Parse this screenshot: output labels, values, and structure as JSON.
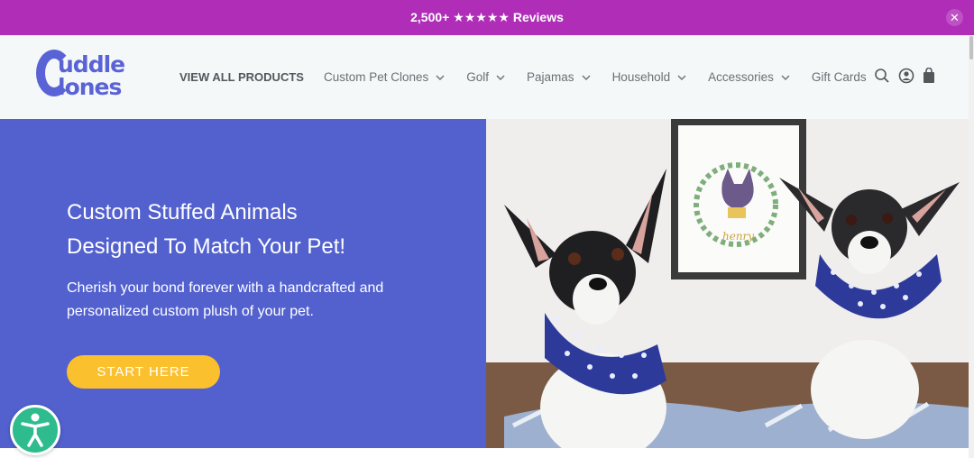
{
  "announcement": {
    "text": "2,500+ ★★★★★ Reviews",
    "close_icon": "close-icon"
  },
  "logo": {
    "line1": "uddle",
    "line2": "lones",
    "alt": "Cuddle Clones"
  },
  "nav": {
    "items": [
      {
        "label": "VIEW ALL PRODUCTS",
        "dropdown": false
      },
      {
        "label": "Custom Pet Clones",
        "dropdown": true
      },
      {
        "label": "Golf",
        "dropdown": true
      },
      {
        "label": "Pajamas",
        "dropdown": true
      },
      {
        "label": "Household",
        "dropdown": true
      },
      {
        "label": "Accessories",
        "dropdown": true
      },
      {
        "label": "Gift Cards",
        "dropdown": false
      }
    ],
    "icons": [
      "search-icon",
      "account-icon",
      "cart-icon"
    ]
  },
  "hero": {
    "title_line1": "Custom Stuffed Animals",
    "title_line2": "Designed To Match Your Pet!",
    "subtitle_line1": "Cherish your bond forever with a handcrafted and",
    "subtitle_line2": "personalized custom plush of your pet.",
    "cta_label": "START HERE",
    "artwork_text": "henry"
  },
  "colors": {
    "announcement_bg": "#b02db8",
    "header_bg": "#f4f8f9",
    "hero_bg": "#5361cf",
    "cta_bg": "#fbc02d",
    "logo": "#5a63d6",
    "accessibility": "#2ebc8f"
  },
  "accessibility_button": {
    "icon": "accessibility-icon"
  }
}
